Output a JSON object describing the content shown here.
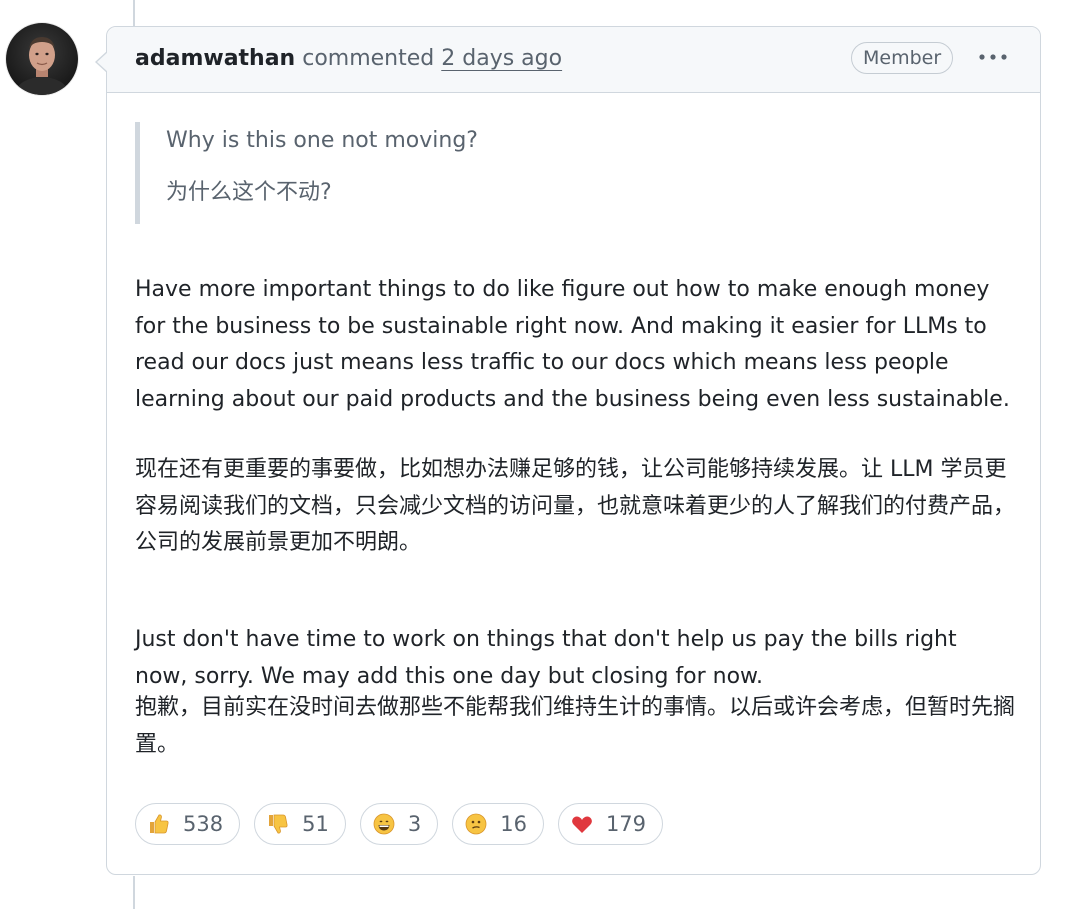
{
  "comment": {
    "author": "adamwathan",
    "action": "commented",
    "timestamp": "2 days ago",
    "badge": "Member",
    "quote": [
      "Why is this one not moving?",
      "为什么这个不动?"
    ],
    "paragraphs": [
      "Have more important things to do like figure out how to make enough money for the business to be sustainable right now. And making it easier for LLMs to read our docs just means less traffic to our docs which means less people learning about our paid products and the business being even less sustainable.",
      "现在还有更重要的事要做，比如想办法赚足够的钱，让公司能够持续发展。让 LLM 学员更容易阅读我们的文档，只会减少文档的访问量，也就意味着更少的人了解我们的付费产品，公司的发展前景更加不明朗。",
      "Just don't have time to work on things that don't help us pay the bills right now, sorry. We may add this one day but closing for now.",
      "抱歉，目前实在没时间去做那些不能帮我们维持生计的事情。以后或许会考虑，但暂时先搁置。"
    ],
    "reactions": [
      {
        "icon": "thumbs-up",
        "count": "538"
      },
      {
        "icon": "thumbs-down",
        "count": "51"
      },
      {
        "icon": "laugh",
        "count": "3"
      },
      {
        "icon": "confused",
        "count": "16"
      },
      {
        "icon": "heart",
        "count": "179"
      }
    ]
  },
  "colors": {
    "border": "#d0d7de",
    "header_bg": "#f6f8fa",
    "text": "#1f2328",
    "muted": "#59636e"
  }
}
